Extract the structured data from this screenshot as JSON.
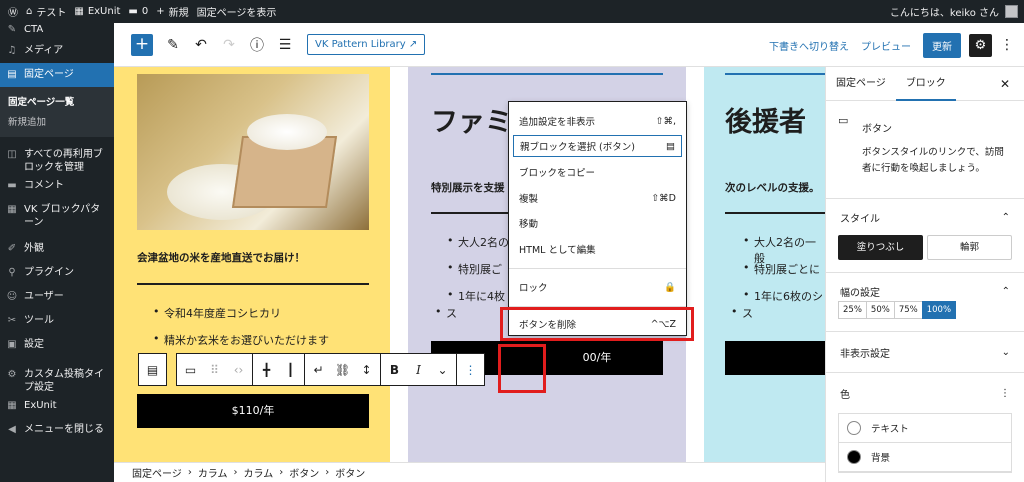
{
  "adminbar": {
    "site": "テスト",
    "exunit": "ExUnit",
    "comments": "0",
    "new": "新規",
    "view": "固定ページを表示",
    "greeting": "こんにちは、keiko さん"
  },
  "sidebar": {
    "items": [
      {
        "label": "CTA"
      },
      {
        "label": "メディア"
      },
      {
        "label": "固定ページ"
      },
      {
        "label": "すべての再利用ブロックを管理"
      },
      {
        "label": "コメント"
      },
      {
        "label": "VK ブロックパターン"
      },
      {
        "label": "外観"
      },
      {
        "label": "プラグイン"
      },
      {
        "label": "ユーザー"
      },
      {
        "label": "ツール"
      },
      {
        "label": "設定"
      },
      {
        "label": "カスタム投稿タイプ設定"
      },
      {
        "label": "ExUnit"
      },
      {
        "label": "メニューを閉じる"
      }
    ],
    "sub": {
      "all": "固定ページ一覧",
      "new": "新規追加"
    }
  },
  "toolbar": {
    "vk_pattern": "VK Pattern Library",
    "draft": "下書きへ切り替え",
    "preview": "プレビュー",
    "update": "更新"
  },
  "content": {
    "col1": {
      "tagline": "会津盆地の米を産地直送でお届け！",
      "bullets": [
        "令和4年度産コシヒカリ",
        "精米か玄米をお選びいただけます"
      ],
      "price": "$110/年"
    },
    "col2": {
      "title": "ファミ",
      "tagline": "特別展示を支援",
      "bullets": [
        "大人2名の",
        "特別展ご",
        "1年に4枚",
        "ス"
      ],
      "price": "00/年"
    },
    "col3": {
      "title": "後援者",
      "tagline": "次のレベルの支援。",
      "bullets": [
        "大人2名の一般",
        "特別展ごとに",
        "1年に6枚のシ",
        "ス"
      ]
    }
  },
  "dropdown": {
    "items": [
      {
        "label": "追加設定を非表示",
        "shortcut": "⇧⌘,"
      },
      {
        "label": "親ブロックを選択 (ボタン)",
        "shortcut": ""
      },
      {
        "label": "ブロックをコピー",
        "shortcut": ""
      },
      {
        "label": "複製",
        "shortcut": "⇧⌘D"
      },
      {
        "label": "移動",
        "shortcut": ""
      },
      {
        "label": "HTML として編集",
        "shortcut": ""
      },
      {
        "label": "ロック",
        "shortcut": ""
      },
      {
        "label": "ボタンを削除",
        "shortcut": "^⌥Z"
      }
    ]
  },
  "breadcrumb": [
    "固定ページ",
    "カラム",
    "カラム",
    "ボタン",
    "ボタン"
  ],
  "panel": {
    "tabs": [
      "固定ページ",
      "ブロック"
    ],
    "block_name": "ボタン",
    "block_desc": "ボタンスタイルのリンクで、訪問者に行動を喚起しましょう。",
    "style_title": "スタイル",
    "style_options": [
      "塗りつぶし",
      "輪郭"
    ],
    "width_title": "幅の設定",
    "width_options": [
      "25%",
      "50%",
      "75%",
      "100%"
    ],
    "hidden_title": "非表示設定",
    "color_title": "色",
    "colors": [
      "テキスト",
      "背景"
    ]
  },
  "colors": {
    "accent": "#2271b1",
    "highlight": "#e11d1d"
  }
}
